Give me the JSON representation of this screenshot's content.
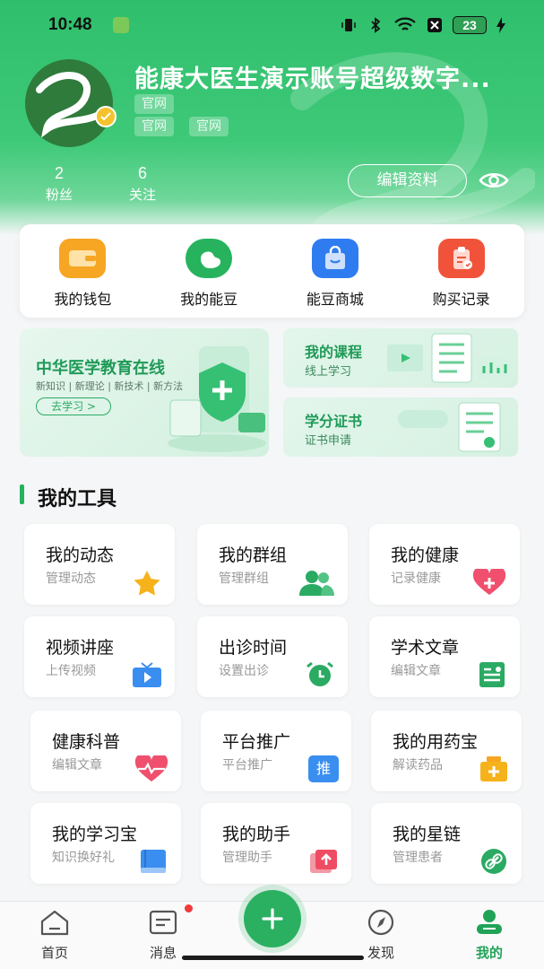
{
  "status_bar": {
    "time": "10:48",
    "battery": "23"
  },
  "profile": {
    "name": "能康大医生演示账号超级数字...",
    "tags_row1": [
      "官网"
    ],
    "tags_row2": [
      "官网",
      "官网"
    ],
    "stats": [
      {
        "value": "2",
        "label": "粉丝"
      },
      {
        "value": "6",
        "label": "关注"
      }
    ],
    "edit_label": "编辑资料"
  },
  "quick_actions": [
    {
      "label": "我的钱包",
      "icon": "wallet-icon",
      "color": "#f6a623"
    },
    {
      "label": "我的能豆",
      "icon": "bean-icon",
      "color": "#27b35e"
    },
    {
      "label": "能豆商城",
      "icon": "shopping-bag-icon",
      "color": "#2f7cf0"
    },
    {
      "label": "购买记录",
      "icon": "clipboard-icon",
      "color": "#f0533a"
    }
  ],
  "banners": {
    "main": {
      "title": "中华医学教育在线",
      "subtitle": "新知识 | 新理论 | 新技术 | 新方法",
      "button": "去学习 >"
    },
    "course": {
      "title": "我的课程",
      "subtitle": "线上学习"
    },
    "certificate": {
      "title": "学分证书",
      "subtitle": "证书申请"
    }
  },
  "tools": {
    "section_title": "我的工具",
    "items": [
      {
        "title": "我的动态",
        "subtitle": "管理动态",
        "icon": "star-icon"
      },
      {
        "title": "我的群组",
        "subtitle": "管理群组",
        "icon": "group-icon"
      },
      {
        "title": "我的健康",
        "subtitle": "记录健康",
        "icon": "heart-plus-icon"
      },
      {
        "title": "视频讲座",
        "subtitle": "上传视频",
        "icon": "tv-icon"
      },
      {
        "title": "出诊时间",
        "subtitle": "设置出诊",
        "icon": "alarm-clock-icon"
      },
      {
        "title": "学术文章",
        "subtitle": "编辑文章",
        "icon": "document-icon"
      },
      {
        "title": "健康科普",
        "subtitle": "编辑文章",
        "icon": "heartbeat-icon"
      },
      {
        "title": "平台推广",
        "subtitle": "平台推广",
        "icon": "promote-icon"
      },
      {
        "title": "我的用药宝",
        "subtitle": "解读药品",
        "icon": "medicine-box-icon"
      },
      {
        "title": "我的学习宝",
        "subtitle": "知识换好礼",
        "icon": "book-icon"
      },
      {
        "title": "我的助手",
        "subtitle": "管理助手",
        "icon": "upload-icon"
      },
      {
        "title": "我的星链",
        "subtitle": "管理患者",
        "icon": "link-icon"
      }
    ],
    "promote_icon_text": "推"
  },
  "tabbar": {
    "tabs": [
      {
        "label": "首页",
        "icon": "home-icon"
      },
      {
        "label": "消息",
        "icon": "message-icon"
      },
      {
        "label": "发现",
        "icon": "compass-icon"
      },
      {
        "label": "我的",
        "icon": "profile-icon"
      }
    ],
    "active_color": "#21a357",
    "fab_icon": "plus-icon"
  }
}
